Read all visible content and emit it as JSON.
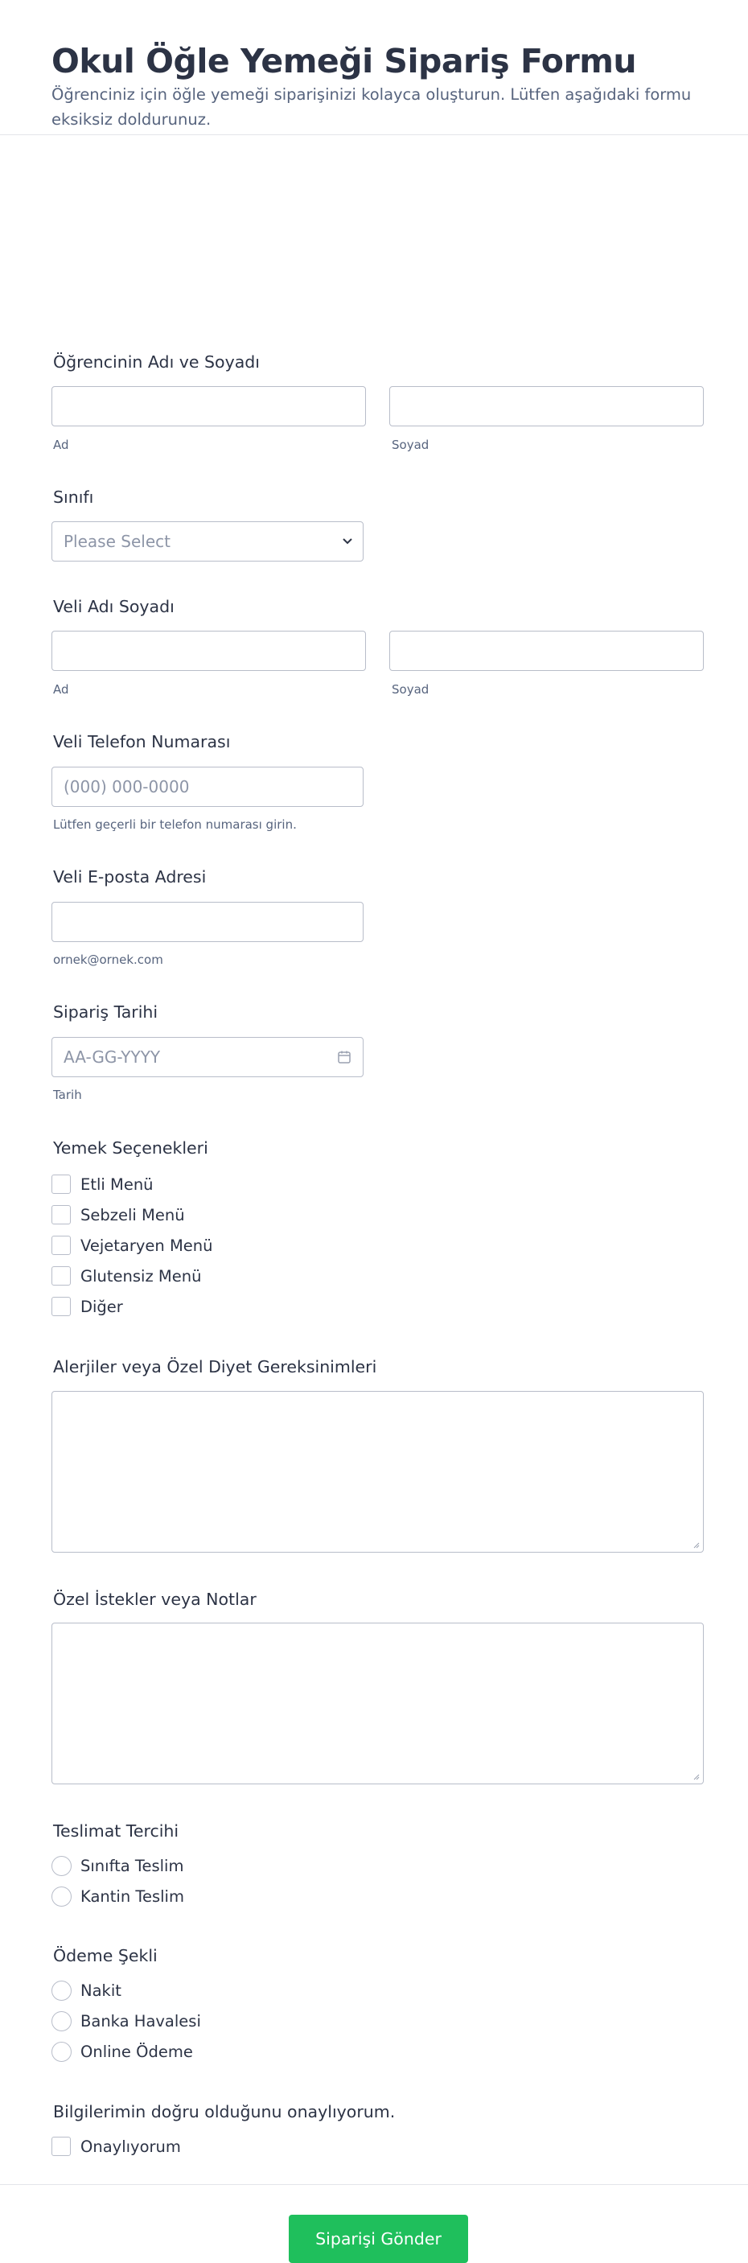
{
  "header": {
    "title": "Okul Öğle Yemeği Sipariş Formu",
    "subtitle": "Öğrenciniz için öğle yemeği siparişinizi kolayca oluşturun. Lütfen aşağıdaki formu eksiksiz doldurunuz."
  },
  "student_name": {
    "label": "Öğrencinin Adı ve Soyadı",
    "first_sub": "Ad",
    "last_sub": "Soyad"
  },
  "grade": {
    "label": "Sınıfı",
    "placeholder": "Please Select"
  },
  "parent_name": {
    "label": "Veli Adı Soyadı",
    "first_sub": "Ad",
    "last_sub": "Soyad"
  },
  "parent_phone": {
    "label": "Veli Telefon Numarası",
    "placeholder": "(000) 000-0000",
    "sub": "Lütfen geçerli bir telefon numarası girin."
  },
  "parent_email": {
    "label": "Veli E-posta Adresi",
    "sub": "ornek@ornek.com"
  },
  "order_date": {
    "label": "Sipariş Tarihi",
    "placeholder": "AA-GG-YYYY",
    "sub": "Tarih"
  },
  "meals": {
    "label": "Yemek Seçenekleri",
    "options": [
      "Etli Menü",
      "Sebzeli Menü",
      "Vejetaryen Menü",
      "Glutensiz Menü",
      "Diğer"
    ]
  },
  "allergies": {
    "label": "Alerjiler veya Özel Diyet Gereksinimleri"
  },
  "notes": {
    "label": "Özel İstekler veya Notlar"
  },
  "delivery": {
    "label": "Teslimat Tercihi",
    "options": [
      "Sınıfta Teslim",
      "Kantin Teslim"
    ]
  },
  "payment": {
    "label": "Ödeme Şekli",
    "options": [
      "Nakit",
      "Banka Havalesi",
      "Online Ödeme"
    ]
  },
  "confirm": {
    "label": "Bilgilerimin doğru olduğunu onaylıyorum.",
    "option": "Onaylıyorum"
  },
  "submit_label": "Siparişi Gönder",
  "colors": {
    "submit": "#1fbf5c",
    "text": "#2c3345",
    "subtext": "#57647e",
    "border": "#b8bdc9"
  }
}
